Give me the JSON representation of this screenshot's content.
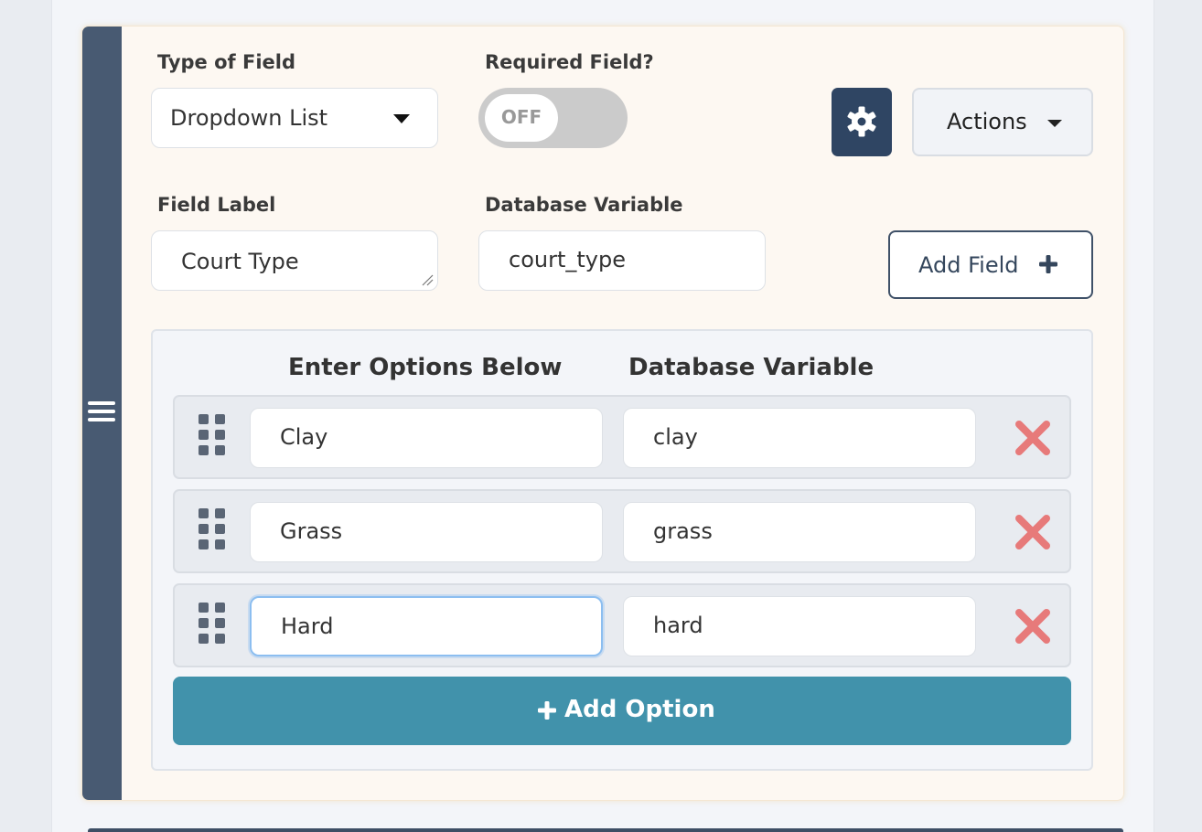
{
  "field": {
    "type_label": "Type of Field",
    "type_value": "Dropdown List",
    "required_label": "Required Field?",
    "required_toggle": "OFF",
    "actions_label": "Actions",
    "label_label": "Field Label",
    "label_value": "Court Type",
    "variable_label": "Database Variable",
    "variable_value": "court_type",
    "add_field_label": "Add Field"
  },
  "options": {
    "header_options": "Enter Options Below",
    "header_variable": "Database Variable",
    "rows": [
      {
        "name": "Clay",
        "variable": "clay"
      },
      {
        "name": "Grass",
        "variable": "grass"
      },
      {
        "name": "Hard",
        "variable": "hard"
      }
    ],
    "add_option_label": "Add Option"
  },
  "icons": {
    "drag_bar": "hamburger-icon",
    "settings": "gear-icon",
    "grip": "grip-icon",
    "remove": "remove-x-icon",
    "add": "plus-icon"
  },
  "colors": {
    "sidebar": "#485a72",
    "settings_button": "#2f4563",
    "add_option": "#4192ab",
    "remove": "#e77a7a",
    "card_background": "#fdf8f2"
  }
}
